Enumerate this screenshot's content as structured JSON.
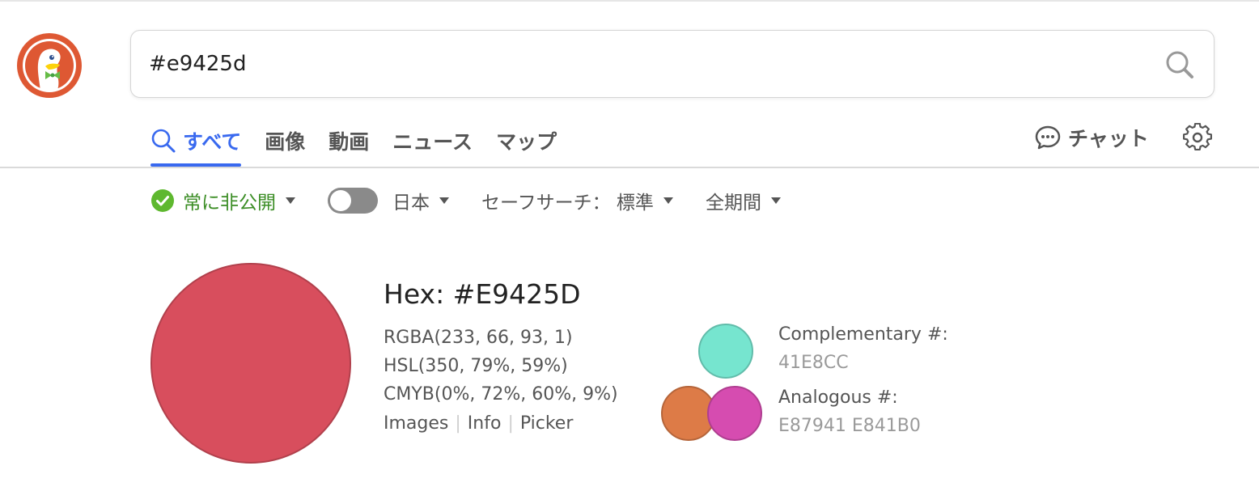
{
  "search": {
    "query": "#e9425d"
  },
  "tabs": [
    {
      "label": "すべて",
      "active": true
    },
    {
      "label": "画像",
      "active": false
    },
    {
      "label": "動画",
      "active": false
    },
    {
      "label": "ニュース",
      "active": false
    },
    {
      "label": "マップ",
      "active": false
    }
  ],
  "chat": {
    "label": "チャット"
  },
  "filters": {
    "privacy": "常に非公開",
    "region": "日本",
    "region_toggle_on": false,
    "safesearch": "セーフサーチ： 標準",
    "time": "全期間"
  },
  "colors": {
    "brand_blue": "#3969ef",
    "privacy_green": "#3b8d25",
    "swatch_main": "#d84e5d",
    "swatch_complementary": "#76e5cf",
    "swatch_analogous_1": "#dd7b47",
    "swatch_analogous_2": "#d64cb0"
  },
  "result": {
    "hex_title": "Hex: #E9425D",
    "rgba": "RGBA(233, 66, 93, 1)",
    "hsl": "HSL(350, 79%, 59%)",
    "cmyb": "CMYB(0%, 72%, 60%, 9%)",
    "links": [
      "Images",
      "Info",
      "Picker"
    ],
    "complementary_label": "Complementary #:",
    "complementary_value": "41E8CC",
    "analogous_label": "Analogous #:",
    "analogous_value": "E87941 E841B0"
  }
}
